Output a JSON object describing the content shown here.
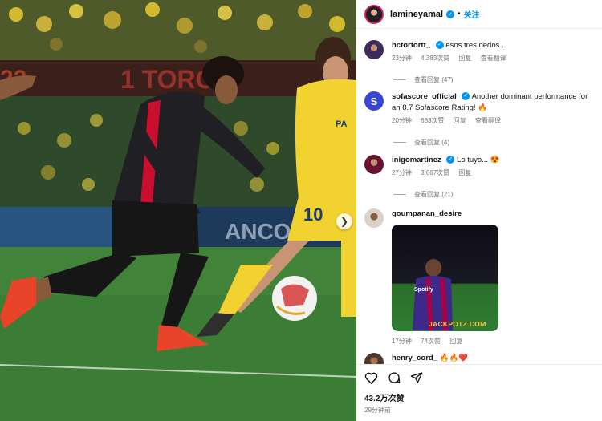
{
  "post": {
    "username": "lamineyamal",
    "follow_label": "关注",
    "separator": "•"
  },
  "photo": {
    "banner_text": "1 TORCID",
    "banner_left_text": "22",
    "ad_text": "ANCON",
    "player_number": "10",
    "sponsor_text": "PA"
  },
  "comments": [
    {
      "user": "hctorfortt_",
      "text": "esos tres dedos...",
      "age": "23分钟",
      "likes": "4,383次赞",
      "reply": "回复",
      "translate": "查看翻译",
      "view_replies": "查看回复 (47)"
    },
    {
      "user": "sofascore_official",
      "text": "Another dominant performance for an 8.7 Sofascore Rating! 🔥",
      "age": "20分钟",
      "likes": "683次赞",
      "reply": "回复",
      "translate": "查看翻译",
      "view_replies": "查看回复 (4)"
    },
    {
      "user": "inigomartinez",
      "text": "Lo tuyo... 😍",
      "age": "27分钟",
      "likes": "3,667次赞",
      "reply": "回复",
      "view_replies": "查看回复 (21)"
    },
    {
      "user": "goumpanan_desire",
      "age": "17分钟",
      "likes": "74次赞",
      "reply": "回复",
      "gif_brand": "JACKPOTZ.COM",
      "gif_sponsor": "Spotify"
    },
    {
      "user": "henry_cord_",
      "text": "🔥🔥❤️"
    }
  ],
  "actions": {
    "likes": "43.2万次赞",
    "time": "29分钟前"
  },
  "icons": [
    "heart-icon",
    "comment-icon",
    "share-icon",
    "chevron-right-icon",
    "verified-icon"
  ],
  "colors": {
    "accent": "#0095f6",
    "barca_red": "#c8102e",
    "villarreal_yellow": "#f2d230"
  }
}
